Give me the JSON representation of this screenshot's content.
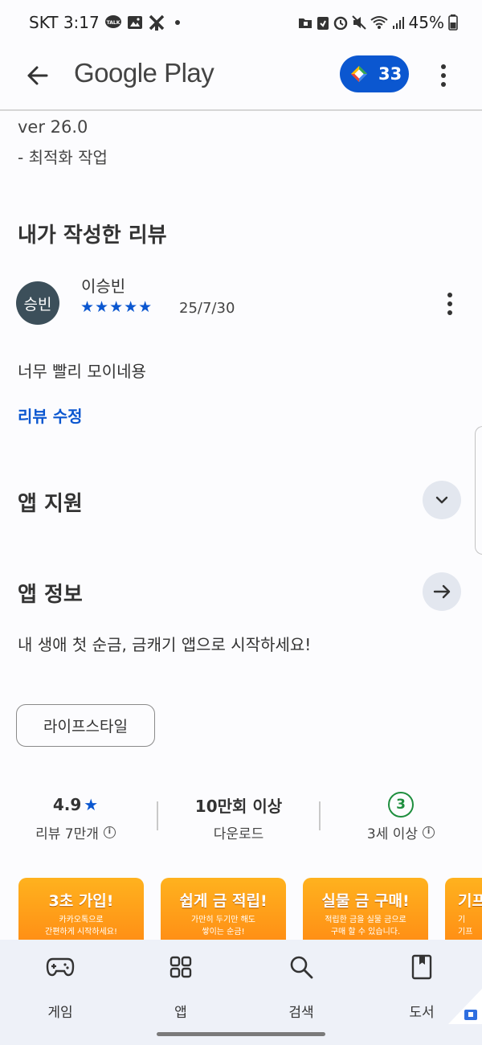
{
  "status_bar": {
    "carrier_time": "SKT 3:17",
    "battery": "45%",
    "talk_badge": "TALK"
  },
  "app_bar": {
    "title": "Google Play",
    "points": "33"
  },
  "whats_new": {
    "version": "ver 26.0",
    "note": "- 최적화 작업"
  },
  "my_review": {
    "section_title": "내가 작성한 리뷰",
    "avatar_text": "승빈",
    "reviewer_name": "이승빈",
    "stars": "★★★★★",
    "rating": 5,
    "date": "25/7/30",
    "text": "너무 빨리 모이네용",
    "edit_label": "리뷰 수정"
  },
  "app_support": {
    "title": "앱 지원"
  },
  "app_info": {
    "title": "앱 정보",
    "description": "내 생애 첫 순금, 금캐기 앱으로 시작하세요!",
    "category_chip": "라이프스타일"
  },
  "stats": {
    "rating_value": "4.9",
    "rating_star": "★",
    "reviews_label": "리뷰 7만개",
    "downloads_value": "10만회 이상",
    "downloads_label": "다운로드",
    "age_badge": "3",
    "age_label": "3세 이상"
  },
  "screenshots": [
    {
      "heading": "3초 가입!",
      "sub1": "카카오톡으로",
      "sub2": "간편하게 시작하세요!"
    },
    {
      "heading": "쉽게 금 적립!",
      "sub1": "가만히 두기만 해도",
      "sub2": "쌓이는 순금!"
    },
    {
      "heading": "실물 금 구매!",
      "sub1": "적립한 금을 실물 금으로",
      "sub2": "구매 할 수 있습니다."
    },
    {
      "heading": "기프",
      "sub1": "기",
      "sub2": "기프"
    }
  ],
  "bottom_nav": {
    "games": "게임",
    "apps": "앱",
    "search": "검색",
    "books": "도서"
  },
  "colors": {
    "accent": "#0b57d0",
    "age_green": "#1e8e3e",
    "nav_bg": "#eef1f8"
  },
  "icons": [
    "back-arrow-icon",
    "more-vert-icon",
    "play-points-icon",
    "chevron-down-icon",
    "arrow-right-icon",
    "info-icon",
    "gamepad-icon",
    "apps-grid-icon",
    "search-icon",
    "book-icon"
  ]
}
